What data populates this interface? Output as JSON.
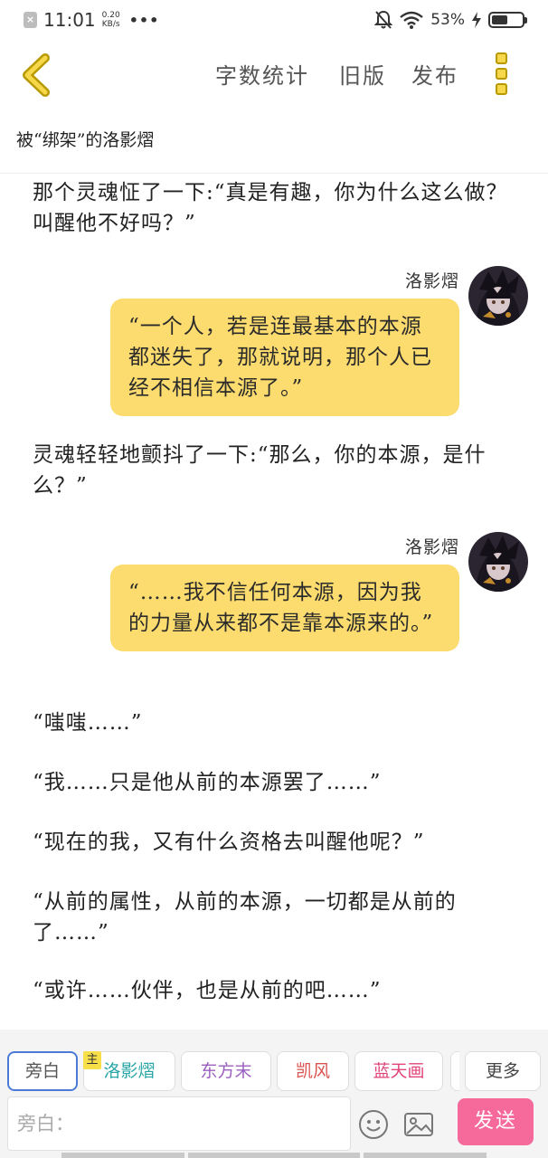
{
  "status_bar": {
    "time": "11:01",
    "net_speed_value": "0.20",
    "net_speed_unit": "KB/s",
    "more_dots": "•••",
    "battery_percent": "53%",
    "battery_level": 0.53
  },
  "toolbar": {
    "word_count": "字数统计",
    "old_version": "旧版",
    "publish": "发布"
  },
  "story": {
    "title": "被“绑架”的洛影熠"
  },
  "messages": [
    {
      "type": "narration",
      "text": "那个灵魂怔了一下:“真是有趣，你为什么这么做？叫醒他不好吗？”"
    },
    {
      "type": "dialogue",
      "speaker": "洛影熠",
      "text": "“一个人，若是连最基本的本源都迷失了，那就说明，那个人已经不相信本源了。”"
    },
    {
      "type": "narration",
      "text": "灵魂轻轻地颤抖了一下:“那么，你的本源，是什么？”"
    },
    {
      "type": "dialogue",
      "speaker": "洛影熠",
      "text": "“……我不信任何本源，因为我的力量从来都不是靠本源来的。”"
    },
    {
      "type": "narration",
      "text": "“嗤嗤……”"
    },
    {
      "type": "narration",
      "text": "“我……只是他从前的本源罢了……”"
    },
    {
      "type": "narration",
      "text": "“现在的我，又有什么资格去叫醒他呢？”"
    },
    {
      "type": "narration",
      "text": "“从前的属性，从前的本源，一切都是从前的了……”"
    },
    {
      "type": "narration",
      "text": "“或许……伙伴，也是从前的吧……”"
    }
  ],
  "characters": [
    {
      "label": "旁白",
      "color": "#555555",
      "selected": true
    },
    {
      "label": "洛影熠",
      "color": "#2aa6a6",
      "main_badge": "主"
    },
    {
      "label": "东方末",
      "color": "#9b5fc0"
    },
    {
      "label": "凯风",
      "color": "#d9534f"
    },
    {
      "label": "蓝天画",
      "color": "#e0457b"
    }
  ],
  "more_label": "更多",
  "input": {
    "placeholder": "旁白："
  },
  "send_label": "发送"
}
